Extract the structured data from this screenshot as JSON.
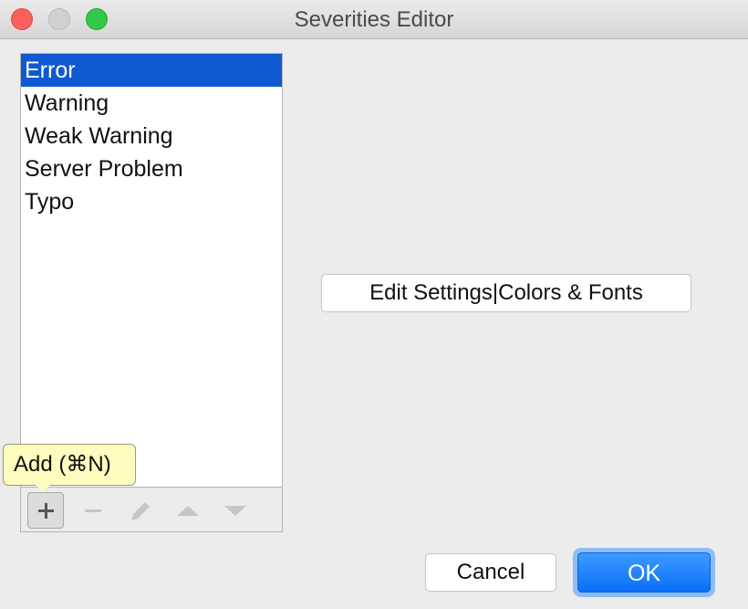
{
  "window": {
    "title": "Severities Editor"
  },
  "severities": {
    "items": [
      {
        "label": "Error",
        "selected": true
      },
      {
        "label": "Warning",
        "selected": false
      },
      {
        "label": "Weak Warning",
        "selected": false
      },
      {
        "label": "Server Problem",
        "selected": false
      },
      {
        "label": "Typo",
        "selected": false
      }
    ]
  },
  "toolbar": {
    "buttons": [
      {
        "icon": "plus-icon",
        "enabled": true
      },
      {
        "icon": "minus-icon",
        "enabled": false
      },
      {
        "icon": "pencil-icon",
        "enabled": false
      },
      {
        "icon": "arrow-up-icon",
        "enabled": false
      },
      {
        "icon": "arrow-down-icon",
        "enabled": false
      }
    ],
    "tooltip": "Add (⌘N)"
  },
  "main": {
    "edit_settings_label": "Edit Settings|Colors & Fonts"
  },
  "footer": {
    "cancel_label": "Cancel",
    "ok_label": "OK"
  },
  "colors": {
    "selection": "#0f59d1",
    "ok_button": "#1a7cfa",
    "tooltip_bg": "#fcfcbf"
  }
}
